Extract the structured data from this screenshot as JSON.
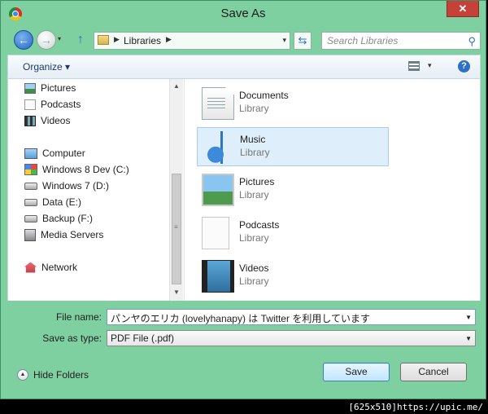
{
  "window": {
    "title": "Save As",
    "close_glyph": "✕"
  },
  "navbar": {
    "back_glyph": "←",
    "forward_glyph": "→",
    "history_glyph": "▾",
    "up_glyph": "↑",
    "address_path": [
      "Libraries"
    ],
    "address_dropdown_glyph": "▾",
    "refresh_glyph": "⇆",
    "search_placeholder": "Search Libraries",
    "search_glyph": "⚲"
  },
  "toolbar": {
    "organize_label": "Organize ▾",
    "views_drop_glyph": "▾",
    "help_glyph": "?"
  },
  "nav_pane": {
    "items": [
      {
        "label": "Pictures",
        "icon": "pictures-icon"
      },
      {
        "label": "Podcasts",
        "icon": "podcasts-icon"
      },
      {
        "label": "Videos",
        "icon": "videos-icon"
      },
      {
        "label": "Computer",
        "icon": "computer-icon"
      },
      {
        "label": "Windows 8 Dev (C:)",
        "icon": "windows-drive-icon"
      },
      {
        "label": "Windows 7 (D:)",
        "icon": "drive-icon"
      },
      {
        "label": "Data (E:)",
        "icon": "drive-icon"
      },
      {
        "label": "Backup (F:)",
        "icon": "drive-icon"
      },
      {
        "label": "Media Servers",
        "icon": "media-server-icon"
      },
      {
        "label": "Network",
        "icon": "network-icon"
      }
    ],
    "scroll_up_glyph": "▲",
    "scroll_down_glyph": "▼",
    "scroll_grip_glyph": "≡"
  },
  "libraries": [
    {
      "name": "Documents",
      "type": "Library",
      "icon": "documents-library-icon",
      "selected": false
    },
    {
      "name": "Music",
      "type": "Library",
      "icon": "music-library-icon",
      "selected": true
    },
    {
      "name": "Pictures",
      "type": "Library",
      "icon": "pictures-library-icon",
      "selected": false
    },
    {
      "name": "Podcasts",
      "type": "Library",
      "icon": "podcasts-library-icon",
      "selected": false
    },
    {
      "name": "Videos",
      "type": "Library",
      "icon": "videos-library-icon",
      "selected": false
    }
  ],
  "form": {
    "file_name_label": "File name:",
    "file_name_value": "パンヤのエリカ (lovelyhanapy) は Twitter を利用しています",
    "save_type_label": "Save as type:",
    "save_type_value": "PDF File (.pdf)",
    "dropdown_glyph": "▼"
  },
  "footer": {
    "hide_folders_label": "Hide Folders",
    "hide_glyph": "▲",
    "save_label": "Save",
    "cancel_label": "Cancel",
    "image_tag": "[625x510]https://upic.me/"
  }
}
